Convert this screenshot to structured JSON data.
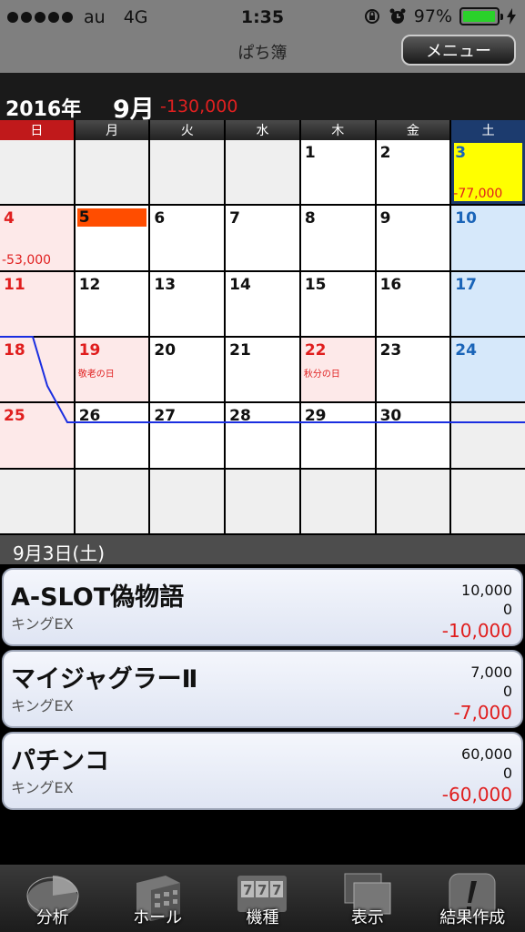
{
  "status": {
    "carrier": "au",
    "network": "4G",
    "time": "1:35",
    "battery": "97%",
    "battery_level": 0.97
  },
  "nav": {
    "title": "ぱち簿",
    "menu_label": "メニュー"
  },
  "month_header": {
    "year": "2016年",
    "month": "9月",
    "total": "-130,000"
  },
  "weekdays": [
    "日",
    "月",
    "火",
    "水",
    "木",
    "金",
    "土"
  ],
  "calendar": {
    "cells": [
      {
        "day": "",
        "type": "empty"
      },
      {
        "day": "",
        "type": "empty"
      },
      {
        "day": "",
        "type": "empty"
      },
      {
        "day": "",
        "type": "empty"
      },
      {
        "day": "1"
      },
      {
        "day": "2"
      },
      {
        "day": "3",
        "type": "sat",
        "selected": true,
        "amount": "-77,000"
      },
      {
        "day": "4",
        "type": "sun",
        "amount": "-53,000"
      },
      {
        "day": "5",
        "today": true
      },
      {
        "day": "6"
      },
      {
        "day": "7"
      },
      {
        "day": "8"
      },
      {
        "day": "9"
      },
      {
        "day": "10",
        "type": "sat"
      },
      {
        "day": "11",
        "type": "sun"
      },
      {
        "day": "12"
      },
      {
        "day": "13"
      },
      {
        "day": "14"
      },
      {
        "day": "15"
      },
      {
        "day": "16"
      },
      {
        "day": "17",
        "type": "sat"
      },
      {
        "day": "18",
        "type": "sun"
      },
      {
        "day": "19",
        "type": "hol",
        "holiday": "敬老の日"
      },
      {
        "day": "20"
      },
      {
        "day": "21"
      },
      {
        "day": "22",
        "type": "hol",
        "holiday": "秋分の日"
      },
      {
        "day": "23"
      },
      {
        "day": "24",
        "type": "sat"
      },
      {
        "day": "25",
        "type": "sun"
      },
      {
        "day": "26"
      },
      {
        "day": "27"
      },
      {
        "day": "28"
      },
      {
        "day": "29"
      },
      {
        "day": "30"
      },
      {
        "day": "",
        "type": "empty"
      },
      {
        "day": "",
        "type": "empty"
      },
      {
        "day": "",
        "type": "empty"
      },
      {
        "day": "",
        "type": "empty"
      },
      {
        "day": "",
        "type": "empty"
      },
      {
        "day": "",
        "type": "empty"
      },
      {
        "day": "",
        "type": "empty"
      },
      {
        "day": "",
        "type": "empty"
      }
    ]
  },
  "selected_day": {
    "label": "9月3日(土)"
  },
  "entries": [
    {
      "name": "A-SLOT偽物語",
      "hall": "キングEX",
      "invest": "10,000",
      "payout": "0",
      "result": "-10,000"
    },
    {
      "name": "マイジャグラーⅡ",
      "hall": "キングEX",
      "invest": "7,000",
      "payout": "0",
      "result": "-7,000"
    },
    {
      "name": "パチンコ",
      "hall": "キングEX",
      "invest": "60,000",
      "payout": "0",
      "result": "-60,000"
    }
  ],
  "tabs": [
    {
      "label": "分析",
      "icon": "pie-chart-icon"
    },
    {
      "label": "ホール",
      "icon": "building-icon"
    },
    {
      "label": "機種",
      "icon": "slot-machine-icon"
    },
    {
      "label": "表示",
      "icon": "layers-icon"
    },
    {
      "label": "結果作成",
      "icon": "edit-icon"
    }
  ],
  "colors": {
    "sunday": "#c0191b",
    "saturday": "#1c3b6e",
    "negative": "#e01e1e",
    "selected": "#ffff00",
    "today": "#ff4d00",
    "trend_line": "#1a2ee0"
  }
}
